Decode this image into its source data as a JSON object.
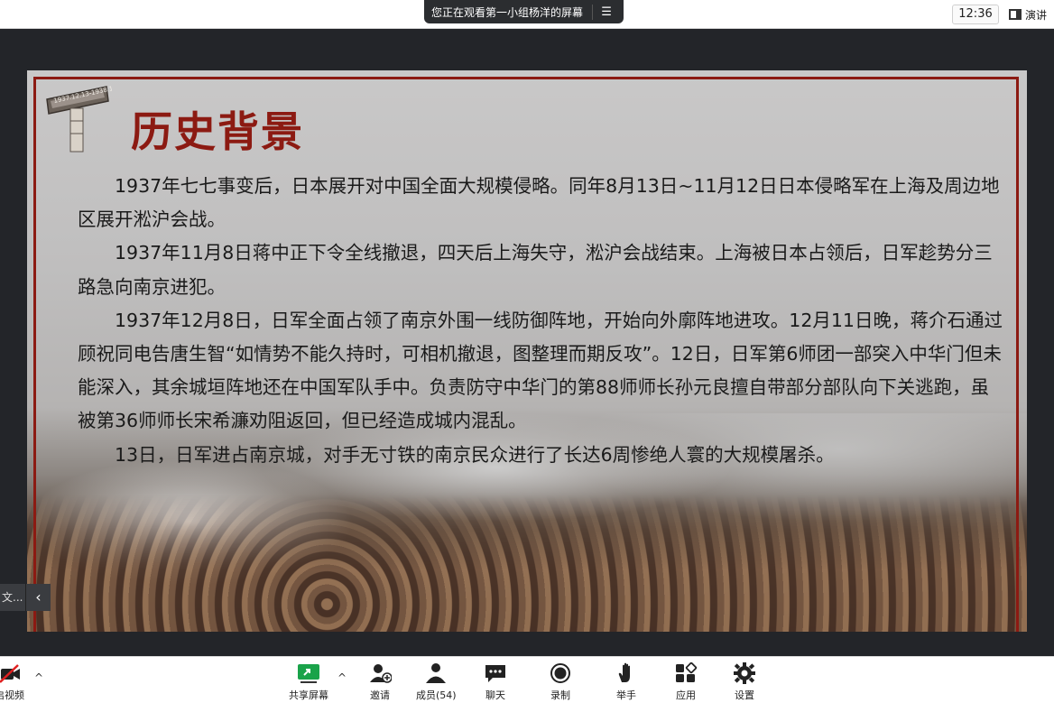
{
  "topbar": {
    "share_notice": "您正在观看第一小组杨洋的屏幕",
    "share_menu_icon": "list-menu-icon",
    "clock": "12:36",
    "view_button_label": "演讲"
  },
  "slide": {
    "monument_text": "1937.12.13-1938.1",
    "title": "历史背景",
    "paragraphs": [
      "1937年七七事变后，日本展开对中国全面大规模侵略。同年8月13日~11月12日日本侵略军在上海及周边地区展开淞沪会战。",
      "1937年11月8日蒋中正下令全线撤退，四天后上海失守，淞沪会战结束。上海被日本占领后，日军趁势分三路急向南京进犯。",
      "1937年12月8日，日军全面占领了南京外围一线防御阵地，开始向外廓阵地进攻。12月11日晚，蒋介石通过顾祝同电告唐生智“如情势不能久持时，可相机撤退，图整理而期反攻”。12日，日军第6师团一部突入中华门但未能深入，其余城垣阵地还在中国军队手中。负责防守中华门的第88师师长孙元良擅自带部分部队向下关逃跑，虽被第36师师长宋希濂劝阻返回，但已经造成城内混乱。",
      "13日，日军进占南京城，对手无寸铁的南京民众进行了长达6周惨绝人寰的大规模屠杀。"
    ],
    "accent_color": "#8c1a12"
  },
  "side_panel": {
    "truncated_label": "文...",
    "collapse_icon": "chevron-left-icon"
  },
  "toolbar": {
    "video_label": "启视频",
    "share_label": "共享屏幕",
    "invite_label": "邀请",
    "members_label": "成员(54)",
    "chat_label": "聊天",
    "record_label": "录制",
    "raise_hand_label": "举手",
    "apps_label": "应用",
    "settings_label": "设置",
    "share_accent": "#1aa34a"
  }
}
